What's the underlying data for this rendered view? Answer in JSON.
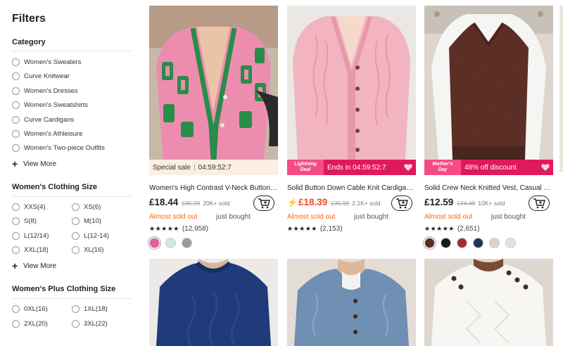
{
  "filters": {
    "title": "Filters",
    "category": {
      "title": "Category",
      "items": [
        {
          "label": "Women's Sweaters"
        },
        {
          "label": "Curve Knitwear"
        },
        {
          "label": "Women's Dresses"
        },
        {
          "label": "Women's Sweatshirts"
        },
        {
          "label": "Curve Cardigans"
        },
        {
          "label": "Women's Athleisure"
        },
        {
          "label": "Women's Two-piece Outfits"
        }
      ],
      "view_more": "View More"
    },
    "clothing_size": {
      "title": "Women's Clothing Size",
      "items": [
        {
          "label": "XXS(4)"
        },
        {
          "label": "XS(6)"
        },
        {
          "label": "S(8)"
        },
        {
          "label": "M(10)"
        },
        {
          "label": "L(12/14)"
        },
        {
          "label": "L(12-14)"
        },
        {
          "label": "XXL(18)"
        },
        {
          "label": "XL(16)"
        }
      ],
      "view_more": "View More"
    },
    "plus_size": {
      "title": "Women's Plus Clothing Size",
      "items": [
        {
          "label": "0XL(16)"
        },
        {
          "label": "1XL(18)"
        },
        {
          "label": "2XL(20)"
        },
        {
          "label": "3XL(22)"
        }
      ]
    }
  },
  "products": [
    {
      "banner_type": "special",
      "banner_label": "Special sale",
      "banner_timer": "04:59:52:7",
      "title": "Women's High Contrast V-Neck Button Cardigan",
      "price": "£18.44",
      "orig_price": "£35.99",
      "sold": "20K+ sold",
      "almost_sold": "Almost sold out",
      "just_bought": "just bought",
      "stars": "★★★★★",
      "reviews": "(12,958)",
      "swatches": [
        "#e0609a",
        "#cfe9dc",
        "#9a9a9e"
      ]
    },
    {
      "banner_type": "flash",
      "badge_line1": "Lightning",
      "badge_line2": "Deal",
      "banner_label": "Ends in 04:59:52:7",
      "title": "Solid Button Down Cable Knit Cardigan, Casual",
      "price": "£18.39",
      "orig_price": "£35.99",
      "sold": "2.1K+ sold",
      "almost_sold": "Almost sold out",
      "just_bought": "just bought",
      "stars": "★★★★★",
      "reviews": "(2,153)"
    },
    {
      "banner_type": "flash",
      "badge_line1": "Mother's",
      "badge_line2": "Day",
      "banner_label": "48% off discount",
      "title": "Solid Crew Neck Knitted Vest, Casual Sleeveless",
      "price": "£12.59",
      "orig_price": "£24.49",
      "sold": "10K+ sold",
      "almost_sold": "Almost sold out",
      "just_bought": "just bought",
      "stars": "★★★★★",
      "reviews": "(2,651)",
      "swatches": [
        "#5a2c25",
        "#1a1a1a",
        "#a52a2a",
        "#1f3556",
        "#d8d4cc",
        "#e6e2da"
      ]
    }
  ],
  "colors": {
    "accent_red": "#e0195c",
    "price_orange": "#f04d20",
    "almost_orange": "#f06a1a"
  }
}
